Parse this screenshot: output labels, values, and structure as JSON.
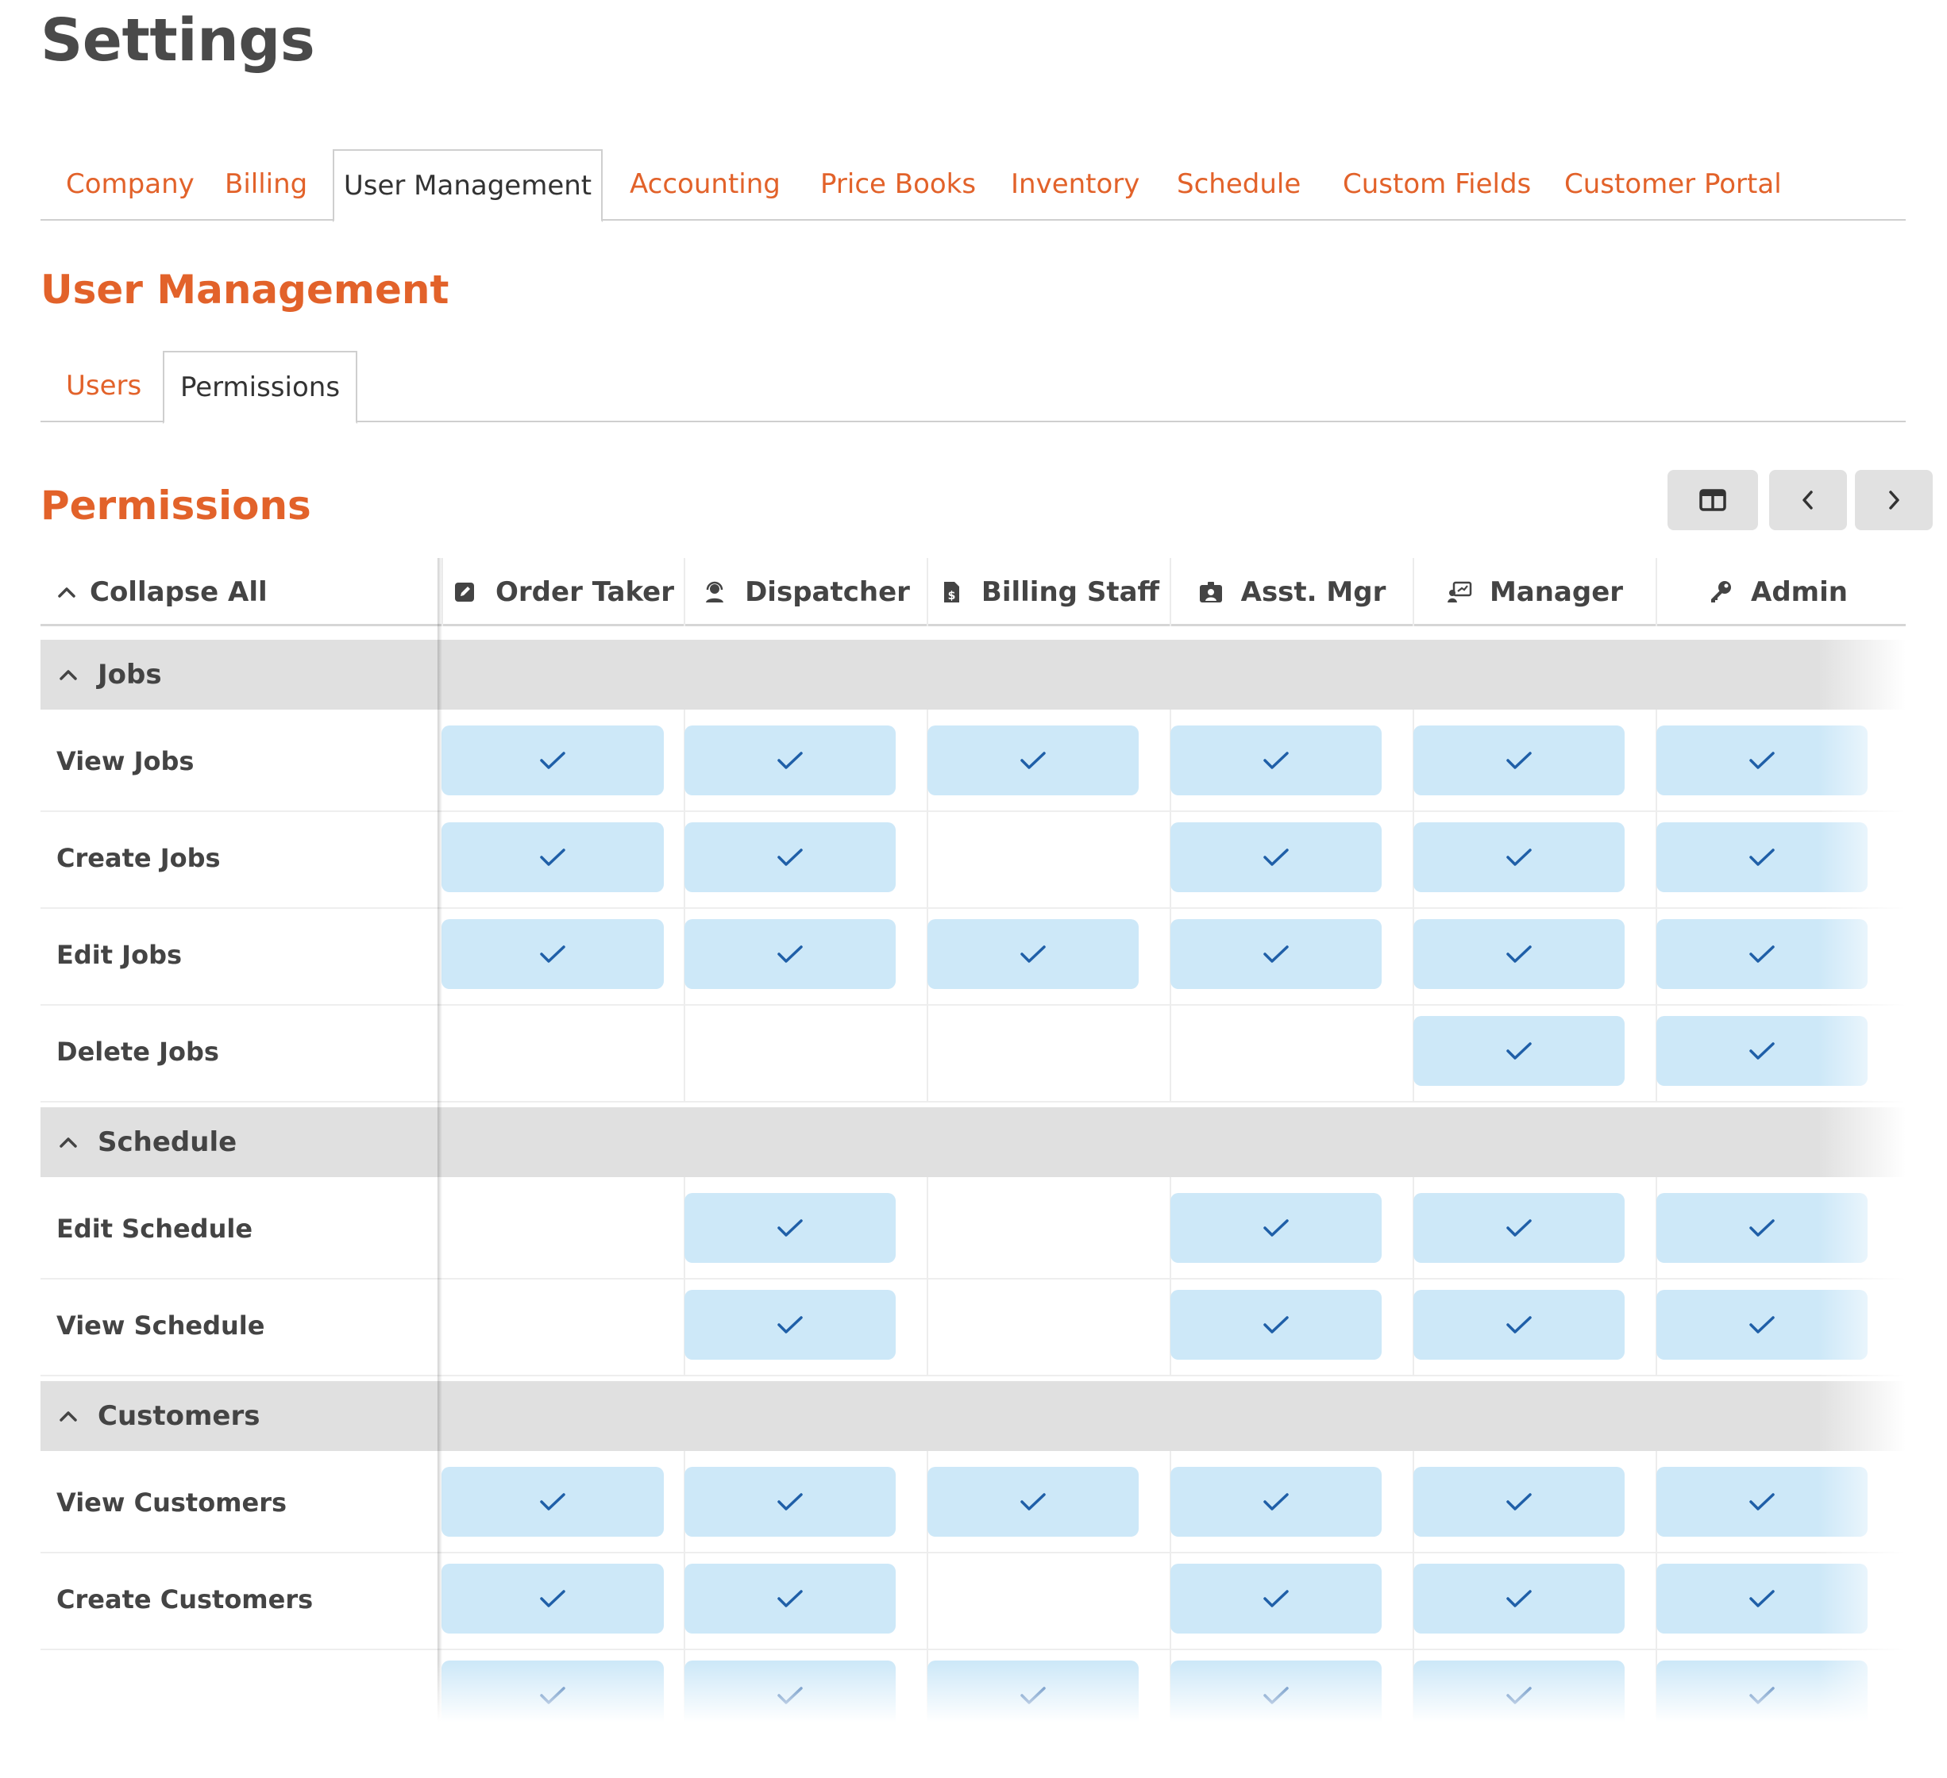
{
  "page": {
    "title": "Settings"
  },
  "main_tabs": [
    {
      "label": "Company",
      "active": false
    },
    {
      "label": "Billing",
      "active": false
    },
    {
      "label": "User Management",
      "active": true
    },
    {
      "label": "Accounting",
      "active": false
    },
    {
      "label": "Price Books",
      "active": false
    },
    {
      "label": "Inventory",
      "active": false
    },
    {
      "label": "Schedule",
      "active": false
    },
    {
      "label": "Custom Fields",
      "active": false
    },
    {
      "label": "Customer Portal",
      "active": false
    }
  ],
  "section": {
    "title": "User Management"
  },
  "sub_tabs": [
    {
      "label": "Users",
      "active": false
    },
    {
      "label": "Permissions",
      "active": true
    }
  ],
  "permissions": {
    "title": "Permissions",
    "toolbar": {
      "columns_icon": "columns-icon",
      "prev_icon": "chevron-left-icon",
      "next_icon": "chevron-right-icon"
    },
    "collapse_all_label": "Collapse All",
    "roles": [
      {
        "label": "Order Taker",
        "icon": "edit-icon"
      },
      {
        "label": "Dispatcher",
        "icon": "headset-icon"
      },
      {
        "label": "Billing Staff",
        "icon": "invoice-icon"
      },
      {
        "label": "Asst. Mgr",
        "icon": "id-badge-icon"
      },
      {
        "label": "Manager",
        "icon": "presentation-icon"
      },
      {
        "label": "Admin",
        "icon": "key-icon"
      }
    ],
    "groups": [
      {
        "label": "Jobs",
        "rows": [
          {
            "label": "View Jobs",
            "values": [
              true,
              true,
              true,
              true,
              true,
              true
            ]
          },
          {
            "label": "Create Jobs",
            "values": [
              true,
              true,
              false,
              true,
              true,
              true
            ]
          },
          {
            "label": "Edit Jobs",
            "values": [
              true,
              true,
              true,
              true,
              true,
              true
            ]
          },
          {
            "label": "Delete Jobs",
            "values": [
              false,
              false,
              false,
              false,
              true,
              true
            ]
          }
        ]
      },
      {
        "label": "Schedule",
        "rows": [
          {
            "label": "Edit Schedule",
            "values": [
              false,
              true,
              false,
              true,
              true,
              true
            ]
          },
          {
            "label": "View Schedule",
            "values": [
              false,
              true,
              false,
              true,
              true,
              true
            ]
          }
        ]
      },
      {
        "label": "Customers",
        "rows": [
          {
            "label": "View Customers",
            "values": [
              true,
              true,
              true,
              true,
              true,
              true
            ]
          },
          {
            "label": "Create Customers",
            "values": [
              true,
              true,
              false,
              true,
              true,
              true
            ]
          },
          {
            "label": "",
            "values": [
              true,
              true,
              true,
              true,
              true,
              true
            ]
          }
        ]
      }
    ],
    "colors": {
      "accent": "#e2622a",
      "check": "#1f5fa8",
      "pill": "#cde8f8",
      "group_bg": "#e0e0e0"
    }
  }
}
